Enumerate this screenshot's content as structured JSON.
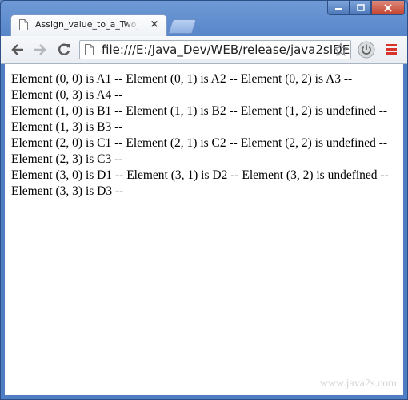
{
  "browser": {
    "tab_title": "Assign_value_to_a_Two_dim",
    "tab_close": "×",
    "url": "file:///E:/Java_Dev/WEB/release/java2sIDE"
  },
  "icons": {
    "tab_page": "page-icon",
    "back": "arrow-left-icon",
    "forward": "arrow-right-icon",
    "reload": "reload-icon",
    "star": "star-icon",
    "extension": "power-icon",
    "menu": "hamburger-menu-icon"
  },
  "colors": {
    "titlebar": "#4f7ec4",
    "close_button": "#c5432f",
    "menu_icon": "#d8322a"
  },
  "content": {
    "lines": [
      "Element (0, 0) is A1 -- Element (0, 1) is A2 -- Element (0, 2) is A3 -- Element (0, 3) is A4 --",
      "Element (1, 0) is B1 -- Element (1, 1) is B2 -- Element (1, 2) is undefined -- Element (1, 3) is B3 --",
      "Element (2, 0) is C1 -- Element (2, 1) is C2 -- Element (2, 2) is undefined -- Element (2, 3) is C3 --",
      "Element (3, 0) is D1 -- Element (3, 1) is D2 -- Element (3, 2) is undefined -- Element (3, 3) is D3 --"
    ],
    "watermark": "www.java2s.com"
  }
}
